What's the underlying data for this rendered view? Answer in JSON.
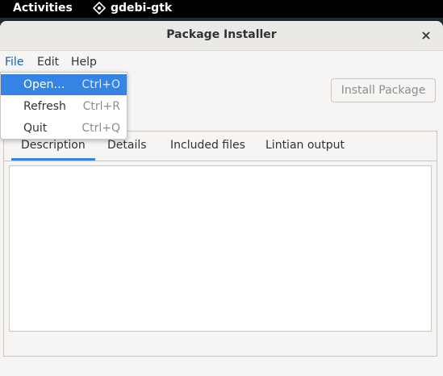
{
  "topbar": {
    "activities": "Activities",
    "app_name": "gdebi-gtk"
  },
  "window": {
    "title": "Package Installer"
  },
  "menubar": {
    "file": "File",
    "edit": "Edit",
    "help": "Help"
  },
  "file_menu": {
    "items": [
      {
        "label": "Open…",
        "accel": "Ctrl+O",
        "highlighted": true
      },
      {
        "label": "Refresh",
        "accel": "Ctrl+R",
        "highlighted": false
      },
      {
        "label": "Quit",
        "accel": "Ctrl+Q",
        "highlighted": false
      }
    ]
  },
  "toolbar": {
    "install_label": "Install Package"
  },
  "tabs": [
    {
      "label": "Description",
      "active": true
    },
    {
      "label": "Details",
      "active": false
    },
    {
      "label": "Included files",
      "active": false
    },
    {
      "label": "Lintian output",
      "active": false
    }
  ],
  "colors": {
    "accent": "#3584e4",
    "window_bg": "#f6f5f4"
  }
}
